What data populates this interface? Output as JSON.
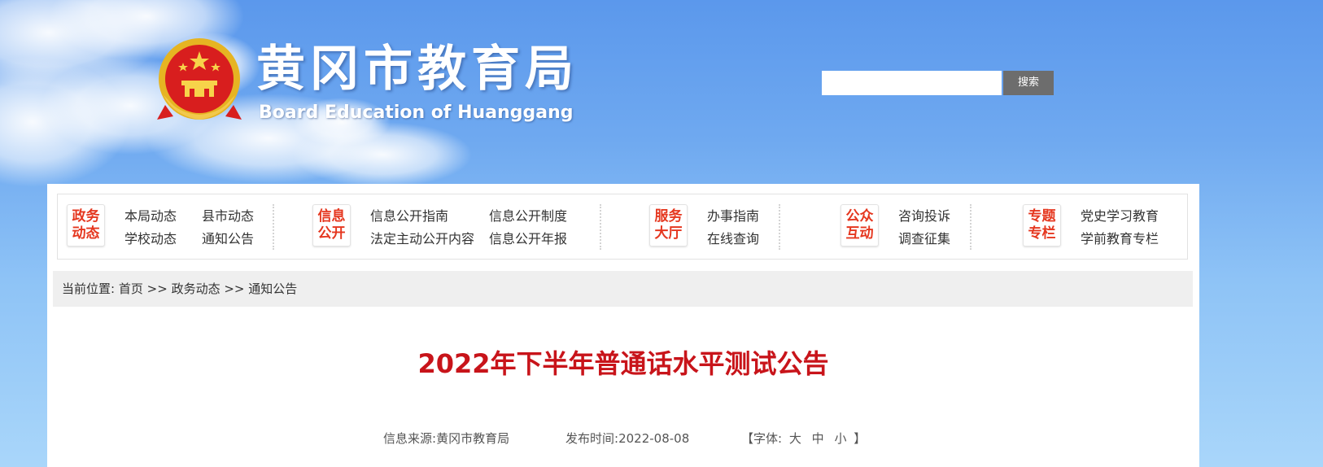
{
  "header": {
    "title": "黄冈市教育局",
    "subtitle": "Board Education of Huanggang"
  },
  "search": {
    "placeholder": "",
    "button_label": "搜索"
  },
  "nav": {
    "groups": [
      {
        "category": [
          "政务",
          "动态"
        ],
        "links": [
          "本局动态",
          "县市动态",
          "学校动态",
          "通知公告"
        ]
      },
      {
        "category": [
          "信息",
          "公开"
        ],
        "links": [
          "信息公开指南",
          "信息公开制度",
          "法定主动公开内容",
          "信息公开年报"
        ]
      },
      {
        "category": [
          "服务",
          "大厅"
        ],
        "links": [
          "办事指南",
          "在线查询"
        ]
      },
      {
        "category": [
          "公众",
          "互动"
        ],
        "links": [
          "咨询投诉",
          "调查征集"
        ]
      },
      {
        "category": [
          "专题",
          "专栏"
        ],
        "links": [
          "党史学习教育",
          "学前教育专栏"
        ]
      }
    ]
  },
  "breadcrumb": {
    "prefix": "当前位置:",
    "items": [
      "首页",
      "政务动态",
      "通知公告"
    ],
    "separator": ">>"
  },
  "article": {
    "title": "2022年下半年普通话水平测试公告",
    "source_label": "信息来源:",
    "source": "黄冈市教育局",
    "date_label": "发布时间:",
    "date": "2022-08-08",
    "font_label": "【字体:",
    "font_sizes": [
      "大",
      "中",
      "小"
    ],
    "font_close": "】"
  },
  "colors": {
    "accent_red": "#c8141a",
    "category_red": "#e5371f",
    "search_button": "#6d6d6d"
  }
}
